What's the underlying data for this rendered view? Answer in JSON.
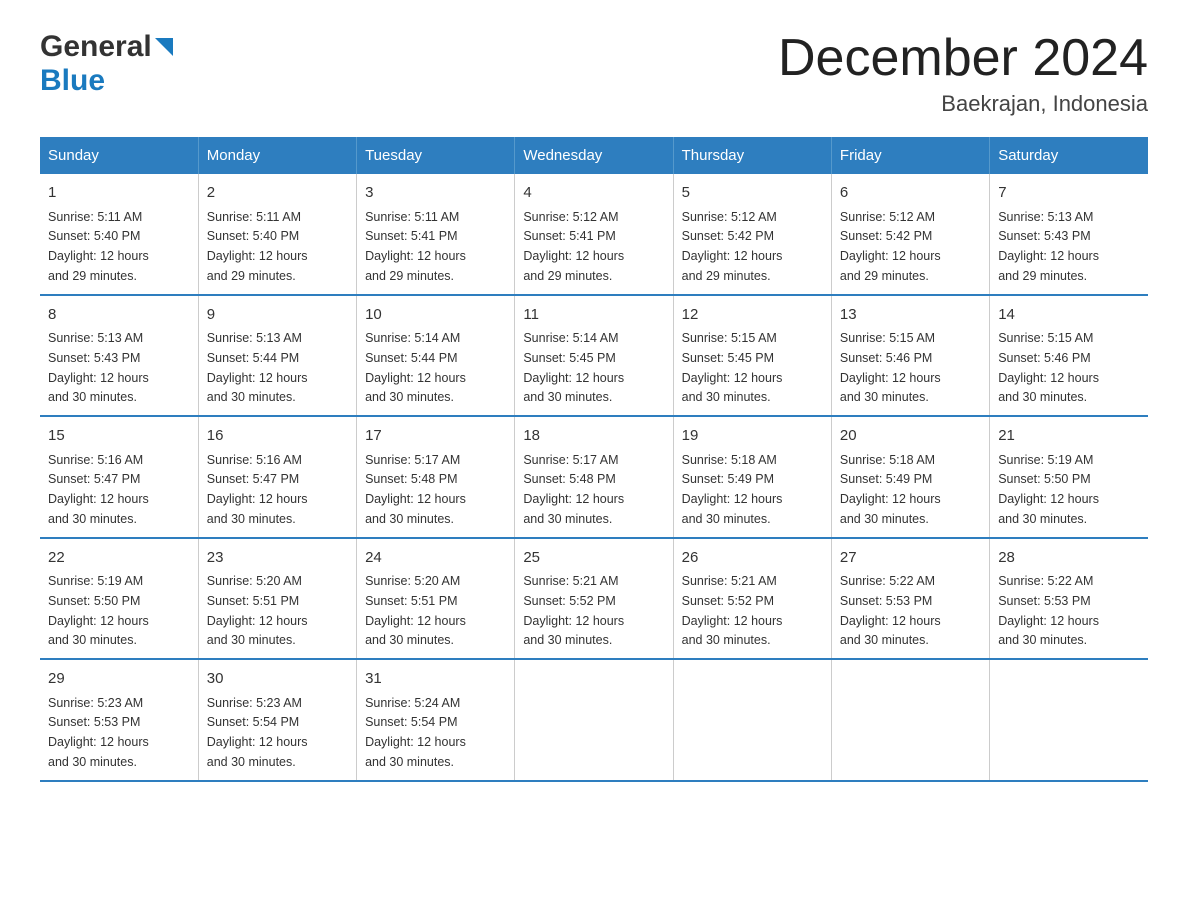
{
  "header": {
    "title": "December 2024",
    "subtitle": "Baekrajan, Indonesia",
    "logo_general": "General",
    "logo_blue": "Blue"
  },
  "days_of_week": [
    "Sunday",
    "Monday",
    "Tuesday",
    "Wednesday",
    "Thursday",
    "Friday",
    "Saturday"
  ],
  "weeks": [
    [
      {
        "day": "1",
        "sunrise": "5:11 AM",
        "sunset": "5:40 PM",
        "daylight": "12 hours and 29 minutes."
      },
      {
        "day": "2",
        "sunrise": "5:11 AM",
        "sunset": "5:40 PM",
        "daylight": "12 hours and 29 minutes."
      },
      {
        "day": "3",
        "sunrise": "5:11 AM",
        "sunset": "5:41 PM",
        "daylight": "12 hours and 29 minutes."
      },
      {
        "day": "4",
        "sunrise": "5:12 AM",
        "sunset": "5:41 PM",
        "daylight": "12 hours and 29 minutes."
      },
      {
        "day": "5",
        "sunrise": "5:12 AM",
        "sunset": "5:42 PM",
        "daylight": "12 hours and 29 minutes."
      },
      {
        "day": "6",
        "sunrise": "5:12 AM",
        "sunset": "5:42 PM",
        "daylight": "12 hours and 29 minutes."
      },
      {
        "day": "7",
        "sunrise": "5:13 AM",
        "sunset": "5:43 PM",
        "daylight": "12 hours and 29 minutes."
      }
    ],
    [
      {
        "day": "8",
        "sunrise": "5:13 AM",
        "sunset": "5:43 PM",
        "daylight": "12 hours and 30 minutes."
      },
      {
        "day": "9",
        "sunrise": "5:13 AM",
        "sunset": "5:44 PM",
        "daylight": "12 hours and 30 minutes."
      },
      {
        "day": "10",
        "sunrise": "5:14 AM",
        "sunset": "5:44 PM",
        "daylight": "12 hours and 30 minutes."
      },
      {
        "day": "11",
        "sunrise": "5:14 AM",
        "sunset": "5:45 PM",
        "daylight": "12 hours and 30 minutes."
      },
      {
        "day": "12",
        "sunrise": "5:15 AM",
        "sunset": "5:45 PM",
        "daylight": "12 hours and 30 minutes."
      },
      {
        "day": "13",
        "sunrise": "5:15 AM",
        "sunset": "5:46 PM",
        "daylight": "12 hours and 30 minutes."
      },
      {
        "day": "14",
        "sunrise": "5:15 AM",
        "sunset": "5:46 PM",
        "daylight": "12 hours and 30 minutes."
      }
    ],
    [
      {
        "day": "15",
        "sunrise": "5:16 AM",
        "sunset": "5:47 PM",
        "daylight": "12 hours and 30 minutes."
      },
      {
        "day": "16",
        "sunrise": "5:16 AM",
        "sunset": "5:47 PM",
        "daylight": "12 hours and 30 minutes."
      },
      {
        "day": "17",
        "sunrise": "5:17 AM",
        "sunset": "5:48 PM",
        "daylight": "12 hours and 30 minutes."
      },
      {
        "day": "18",
        "sunrise": "5:17 AM",
        "sunset": "5:48 PM",
        "daylight": "12 hours and 30 minutes."
      },
      {
        "day": "19",
        "sunrise": "5:18 AM",
        "sunset": "5:49 PM",
        "daylight": "12 hours and 30 minutes."
      },
      {
        "day": "20",
        "sunrise": "5:18 AM",
        "sunset": "5:49 PM",
        "daylight": "12 hours and 30 minutes."
      },
      {
        "day": "21",
        "sunrise": "5:19 AM",
        "sunset": "5:50 PM",
        "daylight": "12 hours and 30 minutes."
      }
    ],
    [
      {
        "day": "22",
        "sunrise": "5:19 AM",
        "sunset": "5:50 PM",
        "daylight": "12 hours and 30 minutes."
      },
      {
        "day": "23",
        "sunrise": "5:20 AM",
        "sunset": "5:51 PM",
        "daylight": "12 hours and 30 minutes."
      },
      {
        "day": "24",
        "sunrise": "5:20 AM",
        "sunset": "5:51 PM",
        "daylight": "12 hours and 30 minutes."
      },
      {
        "day": "25",
        "sunrise": "5:21 AM",
        "sunset": "5:52 PM",
        "daylight": "12 hours and 30 minutes."
      },
      {
        "day": "26",
        "sunrise": "5:21 AM",
        "sunset": "5:52 PM",
        "daylight": "12 hours and 30 minutes."
      },
      {
        "day": "27",
        "sunrise": "5:22 AM",
        "sunset": "5:53 PM",
        "daylight": "12 hours and 30 minutes."
      },
      {
        "day": "28",
        "sunrise": "5:22 AM",
        "sunset": "5:53 PM",
        "daylight": "12 hours and 30 minutes."
      }
    ],
    [
      {
        "day": "29",
        "sunrise": "5:23 AM",
        "sunset": "5:53 PM",
        "daylight": "12 hours and 30 minutes."
      },
      {
        "day": "30",
        "sunrise": "5:23 AM",
        "sunset": "5:54 PM",
        "daylight": "12 hours and 30 minutes."
      },
      {
        "day": "31",
        "sunrise": "5:24 AM",
        "sunset": "5:54 PM",
        "daylight": "12 hours and 30 minutes."
      },
      {
        "day": "",
        "sunrise": "",
        "sunset": "",
        "daylight": ""
      },
      {
        "day": "",
        "sunrise": "",
        "sunset": "",
        "daylight": ""
      },
      {
        "day": "",
        "sunrise": "",
        "sunset": "",
        "daylight": ""
      },
      {
        "day": "",
        "sunrise": "",
        "sunset": "",
        "daylight": ""
      }
    ]
  ]
}
